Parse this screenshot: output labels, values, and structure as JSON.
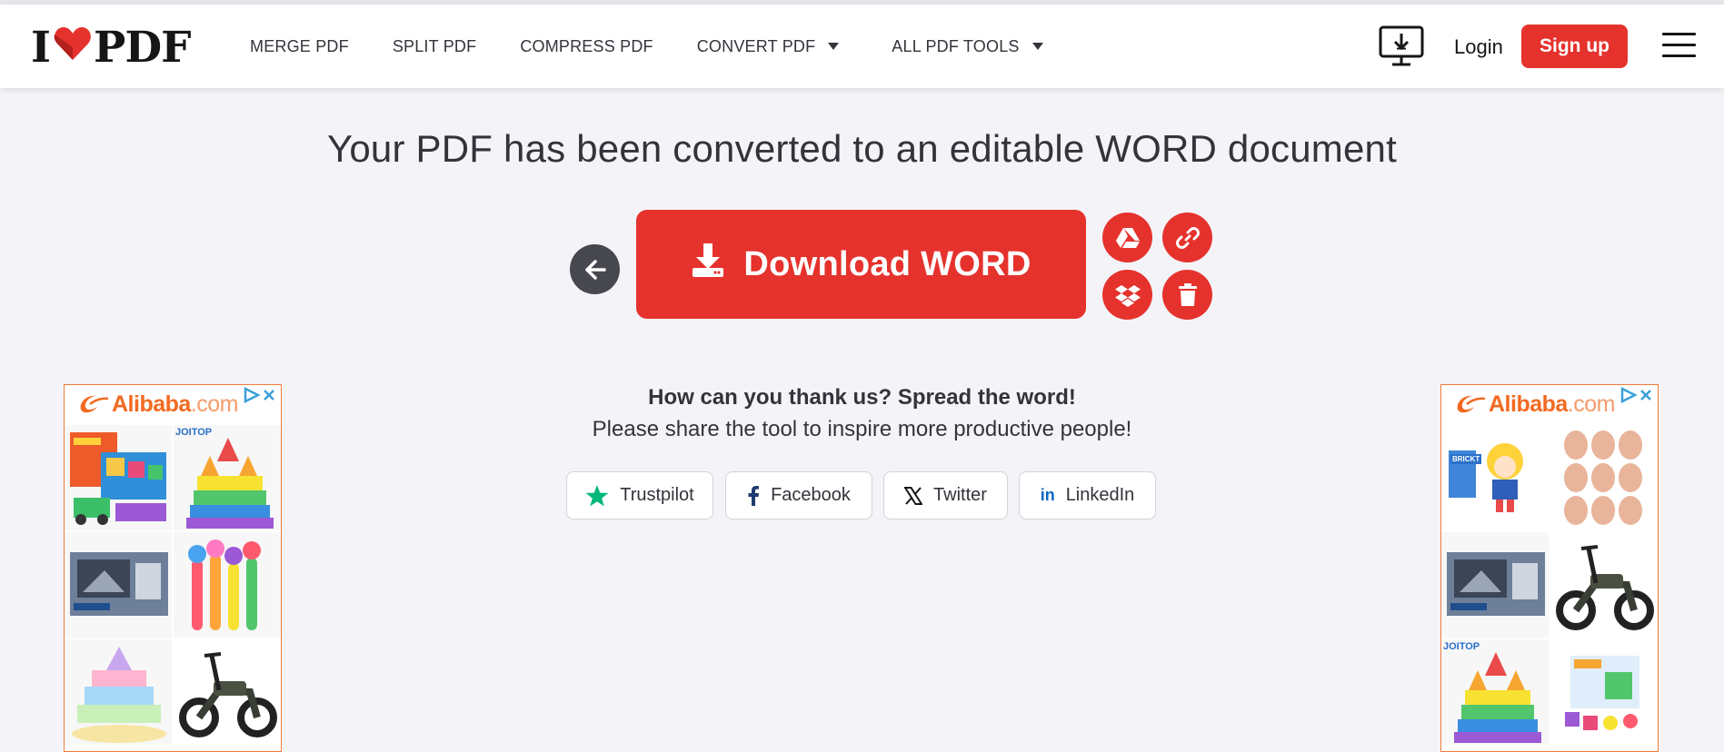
{
  "brand": {
    "logo_left": "I",
    "logo_right": "PDF"
  },
  "nav": {
    "items": [
      {
        "label": "MERGE PDF"
      },
      {
        "label": "SPLIT PDF"
      },
      {
        "label": "COMPRESS PDF"
      },
      {
        "label": "CONVERT PDF"
      },
      {
        "label": "ALL PDF TOOLS"
      }
    ]
  },
  "header": {
    "login_label": "Login",
    "signup_label": "Sign up"
  },
  "main": {
    "title": "Your PDF has been converted to an editable WORD document",
    "download_label": "Download WORD",
    "thanks_heading": "How can you thank us? Spread the word!",
    "share_subtitle": "Please share the tool to inspire more productive people!"
  },
  "share": {
    "buttons": [
      {
        "label": "Trustpilot"
      },
      {
        "label": "Facebook"
      },
      {
        "label": "Twitter"
      },
      {
        "label": "LinkedIn"
      }
    ]
  },
  "ads": {
    "left": {
      "brand": "Alibaba",
      "brand_suffix": ".com",
      "label_joitop": "JOITOP"
    },
    "right": {
      "brand": "Alibaba",
      "brand_suffix": ".com",
      "label_joitop": "JOITOP",
      "label_brickt": "BRICKT"
    }
  },
  "colors": {
    "accent": "#e5322d",
    "text": "#33333b",
    "background": "#f4f4f8",
    "ad_border": "#f07a3a",
    "trustpilot": "#00b67a",
    "facebook": "#1877f2",
    "linkedin": "#0a66c2"
  },
  "icons": {
    "back": "arrow-left-icon",
    "download": "download-icon",
    "drive": "google-drive-icon",
    "link": "link-icon",
    "dropbox": "dropbox-icon",
    "delete": "trash-icon",
    "desktop": "desktop-download-icon",
    "menu": "hamburger-menu-icon"
  }
}
